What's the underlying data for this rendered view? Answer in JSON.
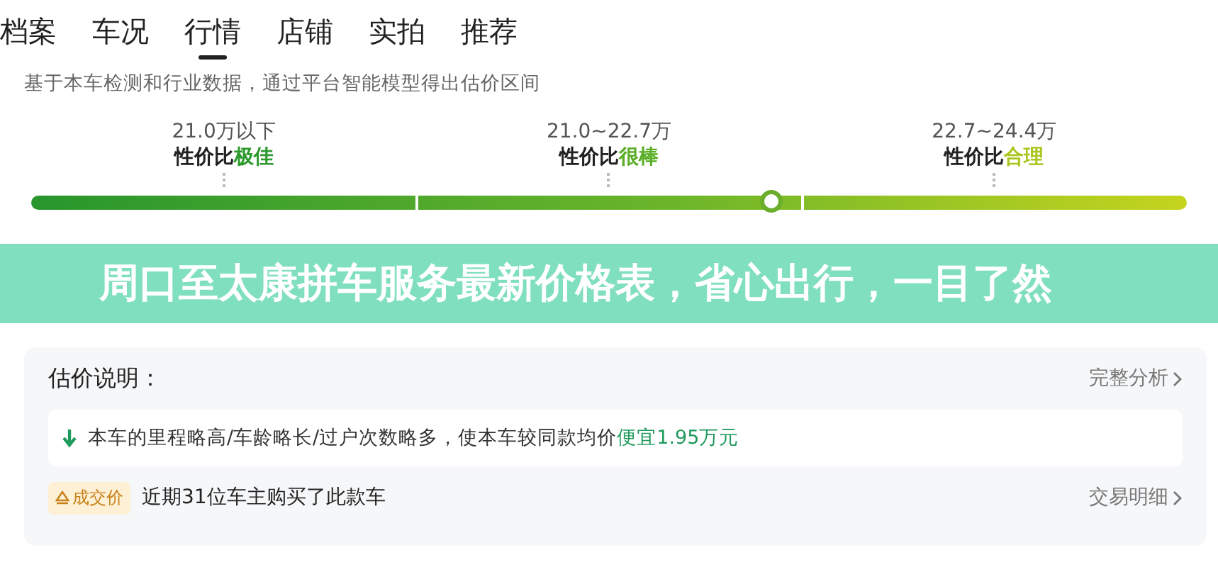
{
  "tabs": [
    {
      "label": "档案",
      "selected": false
    },
    {
      "label": "车况",
      "selected": false
    },
    {
      "label": "行情",
      "selected": true
    },
    {
      "label": "店铺",
      "selected": false
    },
    {
      "label": "实拍",
      "selected": false
    },
    {
      "label": "推荐",
      "selected": false
    }
  ],
  "subtitle": "基于本车检测和行业数据，通过平台智能模型得出估价区间",
  "price_ranges": [
    {
      "range": "21.0万以下",
      "prefix": "性价比",
      "rating": "极佳",
      "color": "#2e9a2e"
    },
    {
      "range": "21.0~22.7万",
      "prefix": "性价比",
      "rating": "很棒",
      "color": "#5aae26"
    },
    {
      "range": "22.7~24.4万",
      "prefix": "性价比",
      "rating": "合理",
      "color": "#a9c61c"
    }
  ],
  "price_meter": {
    "level": 0.64
  },
  "banner": "周口至太康拼车服务最新价格表，省心出行，一目了然",
  "explanation": {
    "title": "估价说明：",
    "link": "完整分析",
    "note": {
      "text": "本车的里程略高/车龄略长/过户次数略多，使本车较同款均价",
      "highlight": "便宜1.95万元"
    },
    "deal": {
      "badge": "成交价",
      "text": "近期31位车主购买了此款车",
      "link": "交易明细"
    }
  }
}
